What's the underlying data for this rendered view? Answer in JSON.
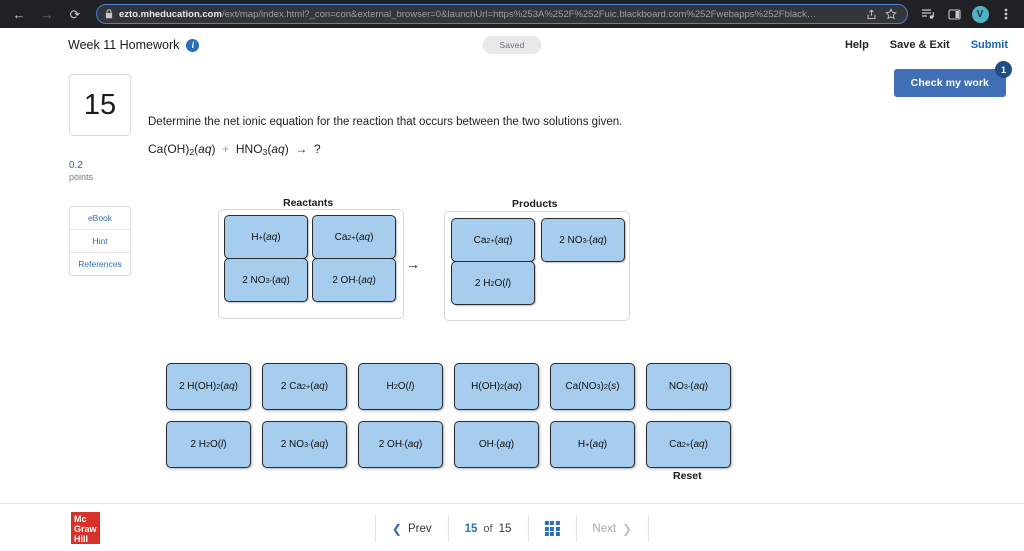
{
  "browser": {
    "back_icon": "arrow-left-icon",
    "forward_icon": "arrow-right-icon",
    "reload_icon": "reload-icon",
    "lock_icon": "lock-icon",
    "url_domain": "ezto.mheducation.com",
    "url_path": "/ext/map/index.html?_con=con&external_browser=0&launchUrl=https%253A%252F%252Fuic.blackboard.com%252Fwebapps%252Fblack…",
    "share_icon": "share-icon",
    "bookmark_icon": "star-icon",
    "reading_list_icon": "reading-list-icon",
    "side_panel_icon": "side-panel-icon",
    "profile_initial": "V",
    "menu_icon": "three-dots-menu-icon"
  },
  "header": {
    "title": "Week 11 Homework",
    "info_icon": "info-icon",
    "saved_label": "Saved",
    "help_label": "Help",
    "save_exit_label": "Save & Exit",
    "submit_label": "Submit"
  },
  "check_work": {
    "label": "Check my work",
    "badge": "1",
    "accent": "#3f6fb5"
  },
  "left_rail": {
    "question_number": "15",
    "points_value": "0.2",
    "points_label": "points",
    "links": [
      {
        "label": "eBook"
      },
      {
        "label": "Hint"
      },
      {
        "label": "References"
      }
    ]
  },
  "question": {
    "prompt": "Determine the net ionic equation for the reaction that occurs between the two solutions given.",
    "equation_html": "Ca(OH)<sub>2</sub>(<i>aq</i>)&nbsp; <span class=\"plus\">+</span> &nbsp;HNO<sub>3</sub>(<i>aq</i>)&nbsp; &rarr; &nbsp;?"
  },
  "workspace": {
    "reactants_label": "Reactants",
    "products_label": "Products",
    "arrow": "→",
    "reactant_tiles": [
      {
        "html": "H<sup>+</sup>(<i>aq</i>)"
      },
      {
        "html": "Ca<sup>2+</sup>(<i>aq</i>)"
      },
      {
        "html": "2 NO<sub>3</sub><sup>-</sup>(<i>aq</i>)"
      },
      {
        "html": "2 OH<sup>-</sup>(<i>aq</i>)"
      }
    ],
    "product_tiles": [
      {
        "html": "Ca<sup>2+</sup>(<i>aq</i>)"
      },
      {
        "html": "2 NO<sub>3</sub><sup>-</sup>(<i>aq</i>)"
      },
      {
        "html": "2 H<sub>2</sub>O(<i>l</i>)"
      }
    ],
    "tile_color": "#a7cdee"
  },
  "answer_bank": {
    "rows": [
      [
        {
          "html": "2 H(OH)<sub>2</sub>(<i>aq</i>)"
        },
        {
          "html": "2 Ca<sup>2+</sup>(<i>aq</i>)"
        },
        {
          "html": "H<sub>2</sub>O(<i>l</i>)"
        },
        {
          "html": "H(OH)<sub>2</sub>(<i>aq</i>)"
        },
        {
          "html": "Ca(NO<sub>3</sub>)<sub>2</sub>(<i>s</i>)"
        },
        {
          "html": "NO<sub>3</sub><sup>-</sup>(<i>aq</i>)"
        }
      ],
      [
        {
          "html": "2 H<sub>2</sub>O(<i>l</i>)"
        },
        {
          "html": "2 NO<sub>3</sub><sup>-</sup>(<i>aq</i>)"
        },
        {
          "html": "2 OH<sup>-</sup>(<i>aq</i>)"
        },
        {
          "html": "OH<sup>-</sup>(<i>aq</i>)"
        },
        {
          "html": "H<sup>+</sup>(<i>aq</i>)"
        },
        {
          "html": "Ca<sup>2+</sup>(<i>aq</i>)"
        }
      ]
    ],
    "reset_label": "Reset"
  },
  "footer": {
    "logo_line1": "Mc",
    "logo_line2": "Graw",
    "logo_line3": "Hill",
    "prev_label": "Prev",
    "current_page": "15",
    "of_label": "of",
    "total_pages": "15",
    "grid_icon": "grid-icon",
    "next_label": "Next"
  }
}
